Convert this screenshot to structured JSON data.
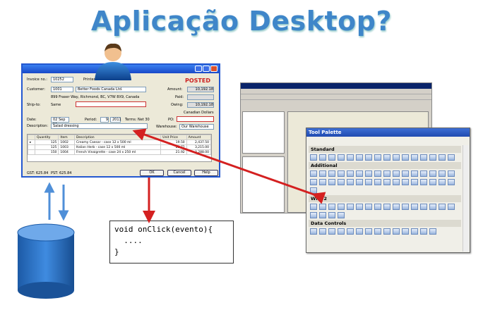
{
  "title": "Aplicação Desktop?",
  "invoice": {
    "invoice_label": "Invoice no.:",
    "invoice_no": "10252",
    "printed": "Printed",
    "status": "POSTED",
    "customer_label": "Customer:",
    "customer_id": "1001",
    "customer_name": "Better Foods Canada Ltd.",
    "address": "899 Fraser Way, Richmond, BC, V7W 8X9, Canada",
    "shipto_label": "Ship-to:",
    "shipto": "Same",
    "amount_label": "Amount:",
    "amount": "10,192.18",
    "paid_label": "Paid:",
    "owing_label": "Owing:",
    "owing": "10,192.18",
    "currency": "Canadian Dollars",
    "date_label": "Date:",
    "date": "02 Sep 11",
    "period_label": "Period:",
    "period": "9",
    "year": "2011",
    "terms": "Terms: Net 30",
    "po_label": "PO:",
    "desc_label": "Description:",
    "description": "Salad dressing",
    "warehouse_label": "Warehouse:",
    "warehouse": "Our Warehouse",
    "columns": [
      "Quantity",
      "Item",
      "Description",
      "Unit Price",
      "Amount"
    ],
    "rows": [
      [
        "125",
        "1002",
        "Creamy Caesar - case 12 x 500 ml",
        "19.50",
        "2,437.50"
      ],
      [
        "125",
        "1003",
        "Italian Herb - case 12 x 500 ml",
        "25.72",
        "3,215.00"
      ],
      [
        "150",
        "1004",
        "French Vinaigrette - case 24 x 250 ml",
        "21.92",
        "3,288.00"
      ]
    ],
    "gst": "GST: 625.84",
    "pst": "PST: 625.84",
    "ok": "OK",
    "cancel": "Cancel",
    "help": "Help"
  },
  "palette": {
    "title": "Tool Palette",
    "sections": [
      "Standard",
      "Additional",
      "Win32",
      "Data Controls"
    ]
  },
  "code": "void onClick(evento){\n  ....\n}"
}
